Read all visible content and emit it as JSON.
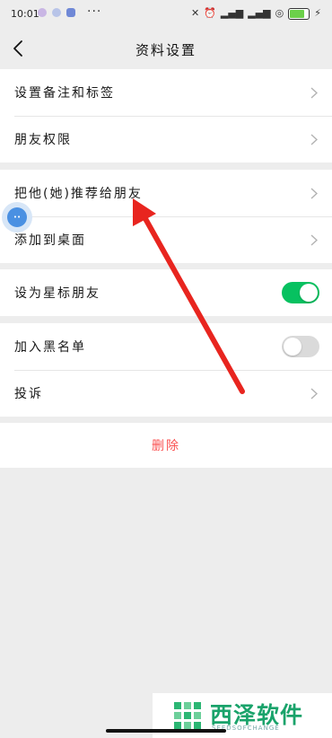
{
  "status_bar": {
    "time": "10:01",
    "more": "···",
    "battery": "100",
    "battery_level": 0.7
  },
  "nav": {
    "title": "资料设置",
    "back_icon": "chevron-left-icon"
  },
  "sections": [
    {
      "rows": [
        {
          "label": "设置备注和标签",
          "type": "chevron"
        },
        {
          "label": "朋友权限",
          "type": "chevron"
        }
      ]
    },
    {
      "rows": [
        {
          "label": "把他(她)推荐给朋友",
          "type": "chevron"
        },
        {
          "label": "添加到桌面",
          "type": "chevron"
        }
      ]
    },
    {
      "rows": [
        {
          "label": "设为星标朋友",
          "type": "toggle",
          "on": true
        }
      ]
    },
    {
      "rows": [
        {
          "label": "加入黑名单",
          "type": "toggle",
          "on": false
        },
        {
          "label": "投诉",
          "type": "chevron"
        }
      ]
    }
  ],
  "delete_label": "删除",
  "colors": {
    "toggle_on": "#07c160",
    "delete_red": "#fa5151",
    "arrow_red": "#e8251f",
    "page_bg": "#ededed"
  },
  "watermark": {
    "title": "西泽软件",
    "subtitle": "SEEDSOFCHANGE"
  }
}
